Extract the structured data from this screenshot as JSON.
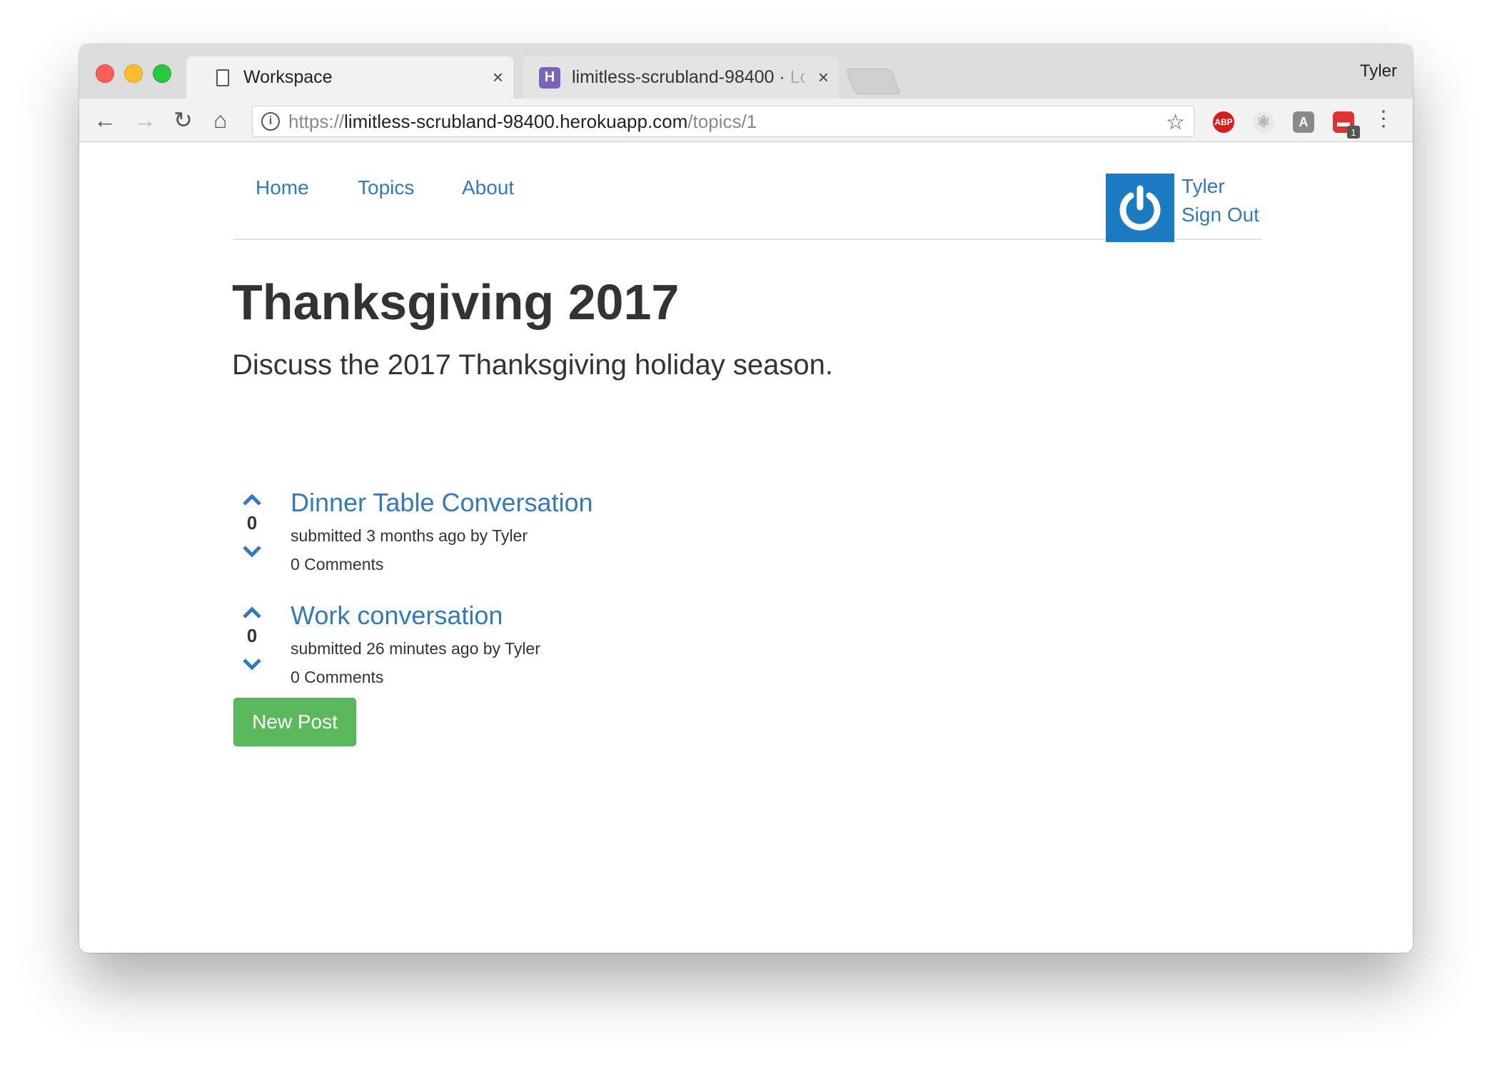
{
  "browser": {
    "profile_name": "Tyler",
    "tabs": [
      {
        "title": "Workspace",
        "close": "×"
      },
      {
        "title": "limitless-scrubland-98400 · ",
        "title_fade": "Lo",
        "close": "×",
        "favicon": "H"
      }
    ],
    "url": {
      "scheme": "https://",
      "host": "limitless-scrubland-98400.herokuapp.com",
      "path": "/topics/1"
    },
    "extensions": [
      {
        "icon": "adblock-plus-icon",
        "label": "ABP"
      },
      {
        "icon": "react-devtools-icon",
        "label": "⚛"
      },
      {
        "icon": "angular-icon",
        "label": "A"
      },
      {
        "icon": "calendar-icon",
        "label": "▬",
        "badge": "1"
      }
    ]
  },
  "nav": {
    "links": [
      "Home",
      "Topics",
      "About"
    ],
    "user": "Tyler",
    "sign_out": "Sign Out"
  },
  "topic": {
    "title": "Thanksgiving 2017",
    "description": "Discuss the 2017 Thanksgiving holiday season."
  },
  "posts": [
    {
      "title": "Dinner Table Conversation",
      "votes": "0",
      "submitted": "submitted 3 months ago by Tyler",
      "comments": "0 Comments"
    },
    {
      "title": "Work conversation",
      "votes": "0",
      "submitted": "submitted 26 minutes ago by Tyler",
      "comments": "0 Comments"
    }
  ],
  "new_post_label": "New Post",
  "colors": {
    "link": "#337ab7",
    "success": "#5cb85c",
    "avatar": "#1c7ac2"
  }
}
